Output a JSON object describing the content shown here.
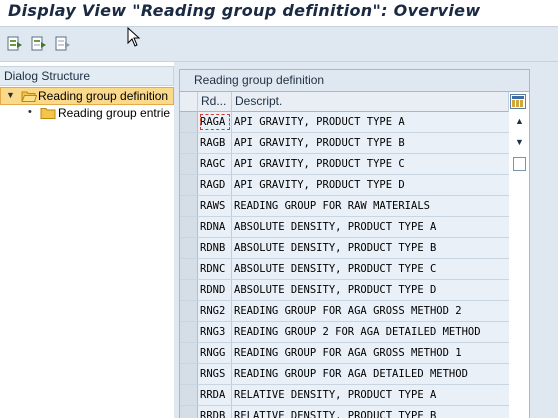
{
  "window": {
    "title": "Display View \"Reading group definition\": Overview"
  },
  "toolbar": {
    "buttons": [
      {
        "icon": "select-all-icon"
      },
      {
        "icon": "select-block-icon"
      },
      {
        "icon": "deselect-all-icon"
      }
    ]
  },
  "dialog_structure": {
    "header": "Dialog Structure",
    "items": [
      {
        "label": "Reading group definition",
        "expanded": true,
        "selected": true
      },
      {
        "label": "Reading group entrie",
        "expanded": false,
        "selected": false
      }
    ]
  },
  "table": {
    "caption": "Reading group definition",
    "columns": [
      "Rd...",
      "Descript."
    ],
    "rows": [
      {
        "key": "RAGA",
        "desc": "API GRAVITY, PRODUCT TYPE A"
      },
      {
        "key": "RAGB",
        "desc": "API GRAVITY, PRODUCT TYPE B"
      },
      {
        "key": "RAGC",
        "desc": "API GRAVITY, PRODUCT TYPE C"
      },
      {
        "key": "RAGD",
        "desc": "API GRAVITY, PRODUCT TYPE D"
      },
      {
        "key": "RAWS",
        "desc": "READING GROUP FOR RAW MATERIALS"
      },
      {
        "key": "RDNA",
        "desc": "ABSOLUTE DENSITY, PRODUCT TYPE A"
      },
      {
        "key": "RDNB",
        "desc": "ABSOLUTE DENSITY, PRODUCT TYPE B"
      },
      {
        "key": "RDNC",
        "desc": "ABSOLUTE DENSITY, PRODUCT TYPE C"
      },
      {
        "key": "RDND",
        "desc": "ABSOLUTE DENSITY, PRODUCT TYPE D"
      },
      {
        "key": "RNG2",
        "desc": "READING GROUP FOR AGA GROSS METHOD 2"
      },
      {
        "key": "RNG3",
        "desc": "READING GROUP 2 FOR AGA DETAILED METHOD"
      },
      {
        "key": "RNGG",
        "desc": "READING GROUP FOR AGA GROSS METHOD 1"
      },
      {
        "key": "RNGS",
        "desc": "READING GROUP FOR AGA DETAILED METHOD"
      },
      {
        "key": "RRDA",
        "desc": "RELATIVE DENSITY, PRODUCT TYPE A"
      },
      {
        "key": "RRDB",
        "desc": "RELATIVE DENSITY, PRODUCT TYPE B"
      }
    ]
  },
  "colors": {
    "toolbar_bg": "#dfe8f1",
    "selected_node": "#fbd98b",
    "cell_bg": "#eaf0f7"
  }
}
